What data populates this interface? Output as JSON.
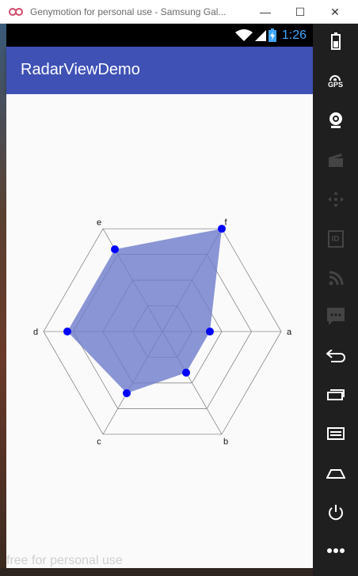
{
  "window": {
    "title": "Genymotion for personal use - Samsung Gal...",
    "minimize_glyph": "—",
    "maximize_glyph": "☐",
    "close_glyph": "✕"
  },
  "status_bar": {
    "time": "1:26"
  },
  "app_bar": {
    "title": "RadarViewDemo"
  },
  "watermark": "free for personal use",
  "sidebar": {
    "items": [
      "battery-icon",
      "gps-icon",
      "camera-icon",
      "capture-icon",
      "dpad-icon",
      "id-icon",
      "cast-icon",
      "sms-icon",
      "back-icon",
      "recent-apps-icon",
      "menu-icon",
      "home-icon",
      "power-icon",
      "more-icon"
    ],
    "gps_label": "GPS",
    "id_label": "ID"
  },
  "colors": {
    "accent": "#3f51b5",
    "radar_fill": "#6d7ccb",
    "radar_point": "#0000ff",
    "time": "#3fa7ff"
  },
  "chart_data": {
    "type": "radar",
    "axes": [
      "a",
      "b",
      "c",
      "d",
      "e",
      "f"
    ],
    "values": [
      0.4,
      0.4,
      0.6,
      0.8,
      0.8,
      1.0
    ],
    "max": 1,
    "rings": 4
  }
}
